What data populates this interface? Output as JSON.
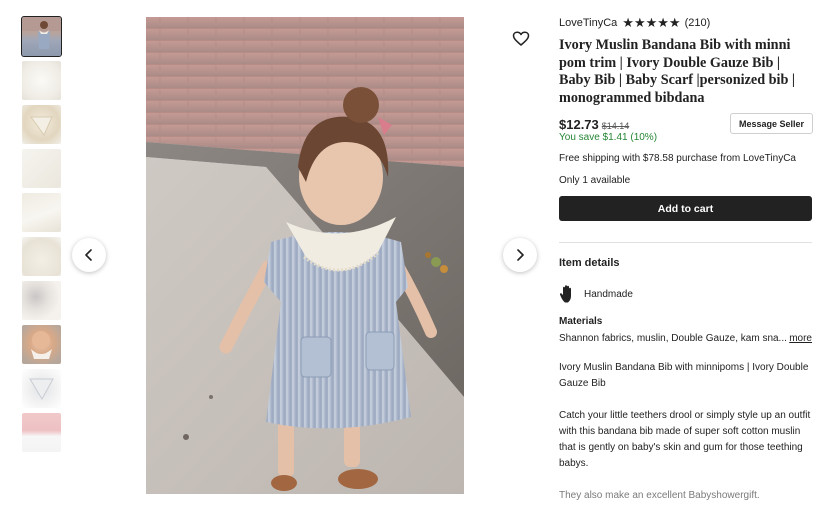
{
  "shop": {
    "name": "LoveTinyCa",
    "stars": "★★★★★",
    "review_count": "(210)",
    "rating": 5
  },
  "listing": {
    "title": "Ivory Muslin Bandana Bib with minni pom trim | Ivory Double Gauze Bib | Baby Bib | Baby Scarf |personized bib | monogrammed bibdana",
    "price": "$12.73",
    "original_price": "$14.14",
    "savings": "You save $1.41 (10%)",
    "shipping": "Free shipping with $78.58 purchase from LoveTinyCa",
    "availability": "Only 1 available"
  },
  "buttons": {
    "message_seller": "Message Seller",
    "add_to_cart": "Add to cart"
  },
  "item_details": {
    "heading": "Item details",
    "handmade": "Handmade",
    "materials_label": "Materials",
    "materials": "Shannon fabrics, muslin, Double Gauze, kam sna...",
    "more": "more",
    "description": [
      "Ivory Muslin Bandana Bib with minnipoms | Ivory Double Gauze Bib",
      "Catch your little teethers drool or simply style up an outfit with this bandana bib made of super soft cotton muslin that is gently on baby's skin and gum for those teething babys.",
      "They also make an excellent Babyshowergift."
    ]
  },
  "gallery": {
    "thumbnail_count": 10,
    "selected_index": 0
  },
  "colors": {
    "accent_dark": "#222222",
    "savings_green": "#258635",
    "muted": "#595959"
  },
  "icons": {
    "favorite": "heart-outline-icon",
    "previous": "chevron-left-icon",
    "next": "chevron-right-icon",
    "handmade": "hand-icon"
  }
}
